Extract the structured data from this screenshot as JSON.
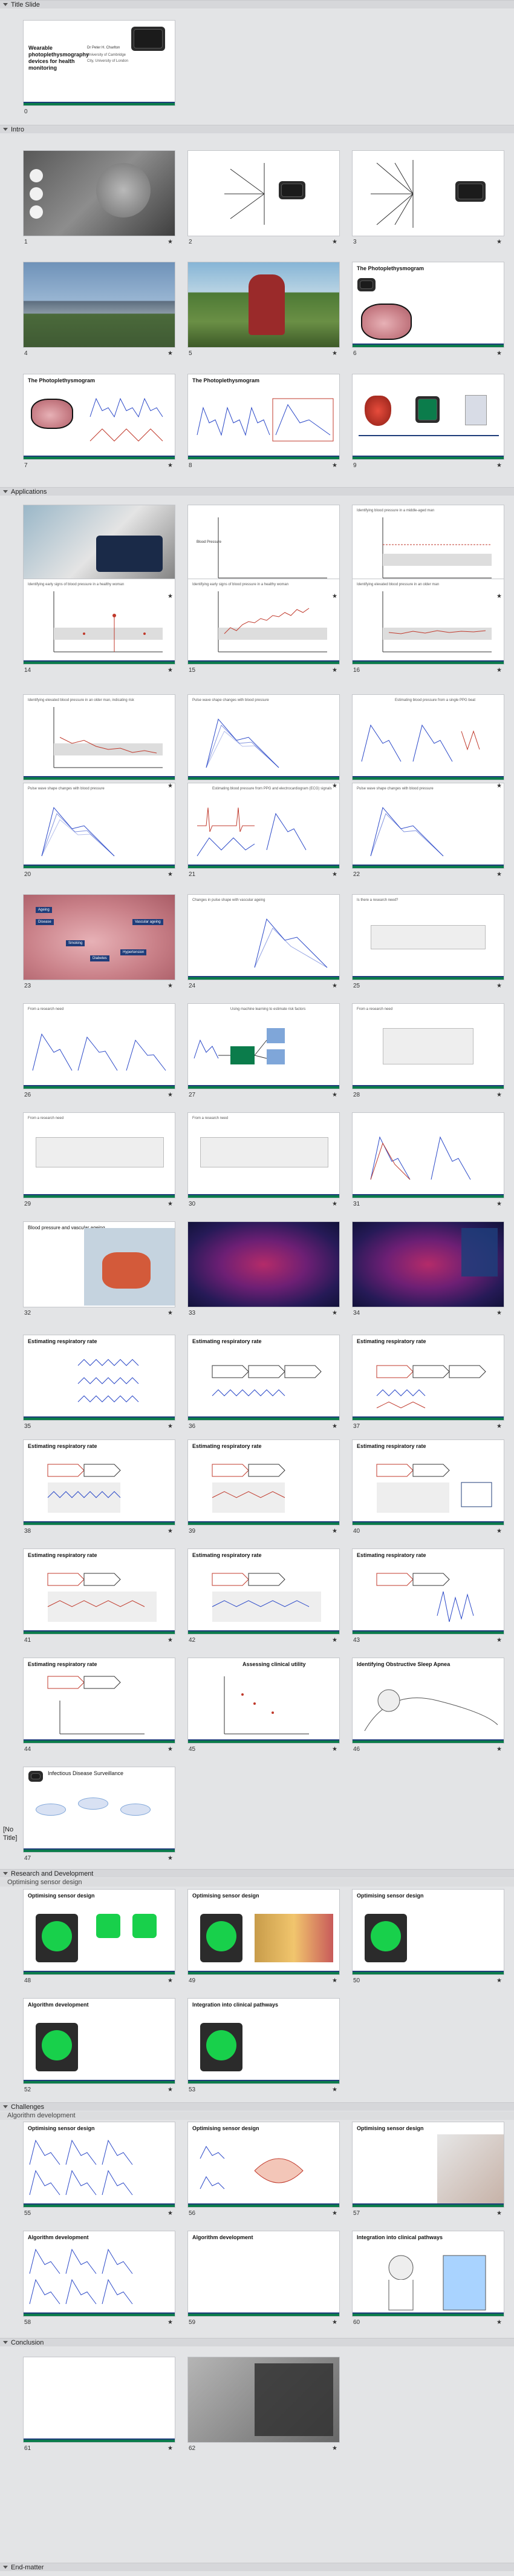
{
  "sections": {
    "title_slide": "Title Slide",
    "intro": "Intro",
    "applications": "Applications",
    "no_title": "[No Title]",
    "research": "Research and Development",
    "research_sub": "Optimising sensor design",
    "challenges": "Challenges",
    "challenges_sub": "Algorithm development",
    "conclusion": "Conclusion",
    "endmatter": "End-matter"
  },
  "slides": {
    "s0": {
      "num": "0",
      "title": "Wearable photoplethysmography devices for health monitoring",
      "author": "Dr Peter H. Charlton",
      "affil": "University of Cambridge",
      "affil2": "City, University of London"
    },
    "s1": {
      "num": "1"
    },
    "s2": {
      "num": "2"
    },
    "s3": {
      "num": "3"
    },
    "s4": {
      "num": "4"
    },
    "s5": {
      "num": "5"
    },
    "s6": {
      "num": "6",
      "title": "The Photoplethysmogram"
    },
    "s7": {
      "num": "7",
      "title": "The Photoplethysmogram"
    },
    "s8": {
      "num": "8",
      "title": "The Photoplethysmogram"
    },
    "s9": {
      "num": "9"
    },
    "s11": {
      "num": "11"
    },
    "s12": {
      "num": "12",
      "ylabel": "Blood Pressure"
    },
    "s13": {
      "num": "13",
      "title": "Identifying blood pressure in a middle-aged man"
    },
    "s14": {
      "num": "14",
      "title": "Identifying early signs of blood pressure in a healthy woman"
    },
    "s15": {
      "num": "15",
      "title": "Identifying early signs of blood pressure in a healthy woman"
    },
    "s16": {
      "num": "16",
      "title": "Identifying elevated blood pressure in an older man"
    },
    "s17": {
      "num": "17",
      "title": "Identifying elevated blood pressure in an older man, indicating risk"
    },
    "s18": {
      "num": "18",
      "title": "Pulse wave shape changes with blood pressure"
    },
    "s19": {
      "num": "19",
      "title": "Estimating blood pressure from a single PPG beat"
    },
    "s20": {
      "num": "20",
      "title": "Pulse wave shape changes with blood pressure"
    },
    "s21": {
      "num": "21",
      "title": "Estimating blood pressure from PPG and electrocardiogram (ECG) signals"
    },
    "s22": {
      "num": "22",
      "title": "Pulse wave shape changes with blood pressure"
    },
    "s23": {
      "num": "23",
      "tags": [
        "Ageing",
        "Disease",
        "Vascular ageing",
        "Smoking",
        "Diabetes",
        "Hypertension"
      ]
    },
    "s24": {
      "num": "24",
      "title": "Changes in pulse shape with vascular ageing"
    },
    "s25": {
      "num": "25",
      "title": "Is there a research need?"
    },
    "s26": {
      "num": "26",
      "title": "From a research need"
    },
    "s27": {
      "num": "27",
      "title": "Using machine learning to estimate risk factors"
    },
    "s28": {
      "num": "28",
      "title": "From a research need"
    },
    "s29": {
      "num": "29",
      "title": "From a research need"
    },
    "s30": {
      "num": "30",
      "title": "From a research need"
    },
    "s31": {
      "num": "31"
    },
    "s32": {
      "num": "32",
      "title": "Blood pressure and vascular ageing"
    },
    "s33": {
      "num": "33"
    },
    "s34": {
      "num": "34"
    },
    "s35": {
      "num": "35",
      "title": "Estimating respiratory rate"
    },
    "s36": {
      "num": "36",
      "title": "Estimating respiratory rate"
    },
    "s37": {
      "num": "37",
      "title": "Estimating respiratory rate"
    },
    "s38": {
      "num": "38",
      "title": "Estimating respiratory rate"
    },
    "s39": {
      "num": "39",
      "title": "Estimating respiratory rate"
    },
    "s40": {
      "num": "40",
      "title": "Estimating respiratory rate"
    },
    "s41": {
      "num": "41",
      "title": "Estimating respiratory rate"
    },
    "s42": {
      "num": "42",
      "title": "Estimating respiratory rate"
    },
    "s43": {
      "num": "43",
      "title": "Estimating respiratory rate"
    },
    "s44": {
      "num": "44",
      "title": "Estimating respiratory rate"
    },
    "s45": {
      "num": "45",
      "title": "Assessing clinical utility"
    },
    "s46": {
      "num": "46",
      "title": "Identifying Obstructive Sleep Apnea"
    },
    "s47": {
      "num": "47",
      "title": "Infectious Disease Surveillance"
    },
    "s48": {
      "num": "48",
      "title": "Optimising sensor design"
    },
    "s49": {
      "num": "49",
      "title": "Optimising sensor design"
    },
    "s50": {
      "num": "50",
      "title": "Optimising sensor design"
    },
    "s51": {
      "num": "51",
      "title": "Optimising sensor design"
    },
    "s52": {
      "num": "52",
      "title": "Algorithm development"
    },
    "s53": {
      "num": "53",
      "title": "Integration into clinical pathways"
    },
    "s55": {
      "num": "55",
      "title": "Optimising sensor design"
    },
    "s56": {
      "num": "56",
      "title": "Optimising sensor design"
    },
    "s57": {
      "num": "57",
      "title": "Optimising sensor design"
    },
    "s58": {
      "num": "58",
      "title": "Algorithm development"
    },
    "s59": {
      "num": "59",
      "title": "Algorithm development"
    },
    "s60": {
      "num": "60",
      "title": "Integration into clinical pathways"
    },
    "s61": {
      "num": "61"
    },
    "s62": {
      "num": "62"
    }
  },
  "star": "★",
  "colors": {
    "accent_green": "#0b7c4b",
    "accent_navy": "#1f3d7a",
    "ppg_blue": "#2a48c8",
    "alert_red": "#c0392b",
    "watch_green": "#18d04b"
  }
}
